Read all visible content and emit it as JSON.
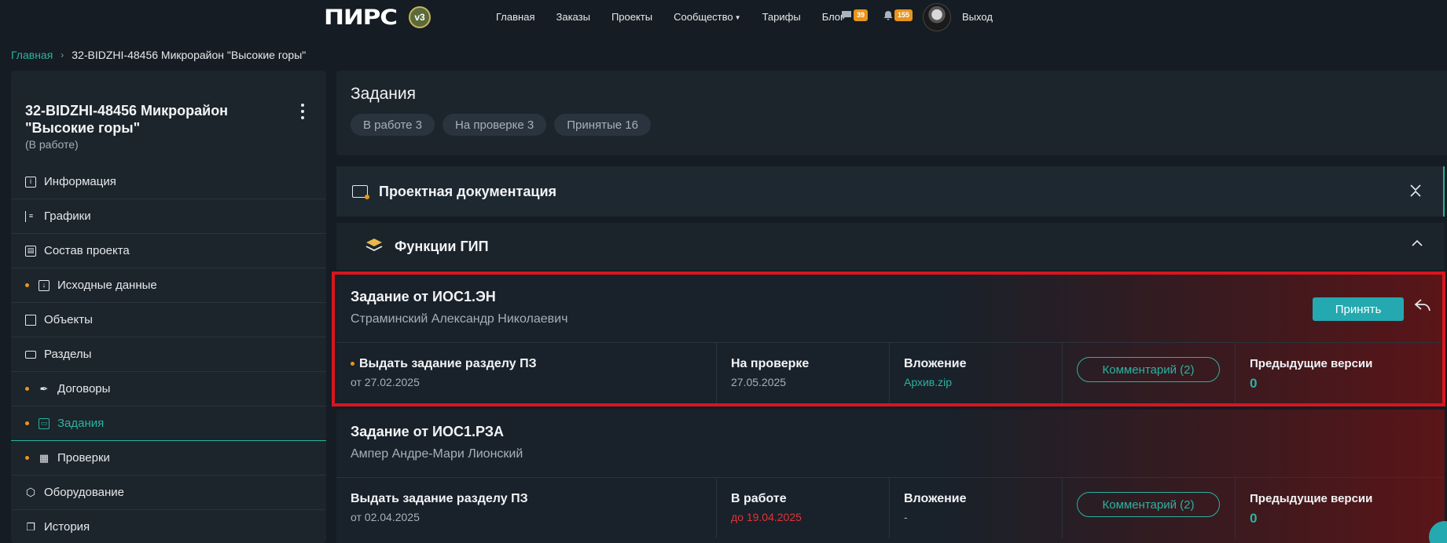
{
  "nav": {
    "logo_text": "ПИРС",
    "logo_badge": "v3",
    "links": [
      "Главная",
      "Заказы",
      "Проекты",
      "Сообщество",
      "Тарифы",
      "Блог"
    ],
    "messages_count": "39",
    "notifications_count": "155",
    "logout": "Выход"
  },
  "breadcrumb": {
    "home": "Главная",
    "current": "32-BIDZHI-48456 Микрорайон \"Высокие горы\""
  },
  "sidebar": {
    "title": "32-BIDZHI-48456 Микрорайон \"Высокие горы\"",
    "status": "(В работе)",
    "items": [
      {
        "label": "Информация"
      },
      {
        "label": "Графики"
      },
      {
        "label": "Состав проекта"
      },
      {
        "label": "Исходные данные"
      },
      {
        "label": "Объекты"
      },
      {
        "label": "Разделы"
      },
      {
        "label": "Договоры"
      },
      {
        "label": "Задания"
      },
      {
        "label": "Проверки"
      },
      {
        "label": "Оборудование"
      },
      {
        "label": "История"
      }
    ]
  },
  "tasks": {
    "title": "Задания",
    "tabs": [
      "В работе 3",
      "На проверке 3",
      "Принятые 16"
    ]
  },
  "sections": {
    "docs": "Проектная документация",
    "gip": "Функции ГИП"
  },
  "cards": [
    {
      "title": "Задание от ИОС1.ЭН",
      "author": "Страминский Александр Николаевич",
      "accept": "Принять",
      "task_name": "Выдать задание разделу ПЗ",
      "task_date": "от 27.02.2025",
      "status": "На проверке",
      "status_date": "27.05.2025",
      "attachment_label": "Вложение",
      "attachment_value": "Архив.zip",
      "comments": "Комментарий (2)",
      "prev_label": "Предыдущие версии",
      "prev_value": "0"
    },
    {
      "title": "Задание от ИОС1.РЗА",
      "author": "Ампер Андре-Мари Лионский",
      "task_name": "Выдать задание разделу ПЗ",
      "task_date": "от 02.04.2025",
      "status": "В работе",
      "status_date": "до 19.04.2025",
      "attachment_label": "Вложение",
      "attachment_value": "-",
      "comments": "Комментарий (2)",
      "prev_label": "Предыдущие версии",
      "prev_value": "0"
    }
  ],
  "colors": {
    "accent": "#2ab3a0",
    "badge": "#e9941d",
    "highlight": "#d8151f",
    "deadline": "#e0343a"
  }
}
